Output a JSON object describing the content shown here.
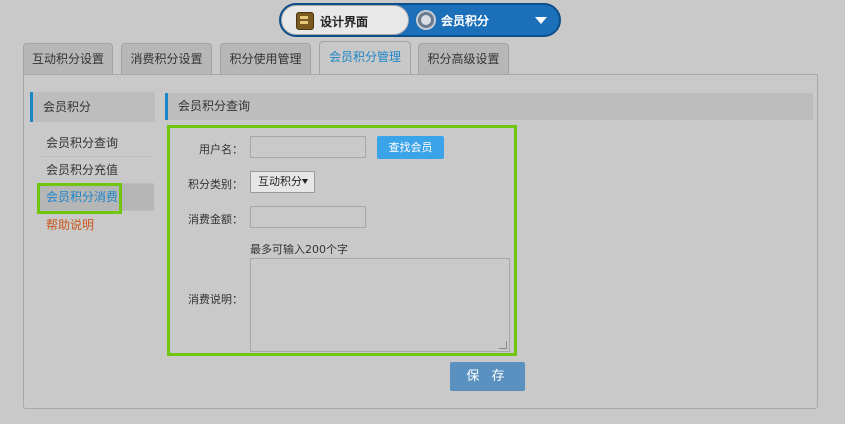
{
  "top_switch": {
    "left_label": "设计界面",
    "right_label": "会员积分"
  },
  "tabs": [
    {
      "label": "互动积分设置"
    },
    {
      "label": "消费积分设置"
    },
    {
      "label": "积分使用管理"
    },
    {
      "label": "会员积分管理",
      "active": true
    },
    {
      "label": "积分高级设置"
    }
  ],
  "sidebar": {
    "title": "会员积分",
    "items": [
      {
        "label": "会员积分查询"
      },
      {
        "label": "会员积分充值"
      },
      {
        "label": "会员积分消费",
        "active": true
      },
      {
        "label": "帮助说明"
      }
    ]
  },
  "content": {
    "title": "会员积分查询",
    "form": {
      "username_label": "用户名：",
      "username_value": "",
      "find_button": "查找会员",
      "type_label": "积分类别：",
      "type_selected": "互动积分",
      "amount_label": "消费金额：",
      "amount_value": "",
      "desc_hint": "最多可输入200个字",
      "desc_label": "消费说明：",
      "desc_value": ""
    },
    "save_button": "保 存"
  },
  "colors": {
    "accent": "#1d86c8",
    "highlight": "#70c50e",
    "help_link": "#c9581e"
  }
}
